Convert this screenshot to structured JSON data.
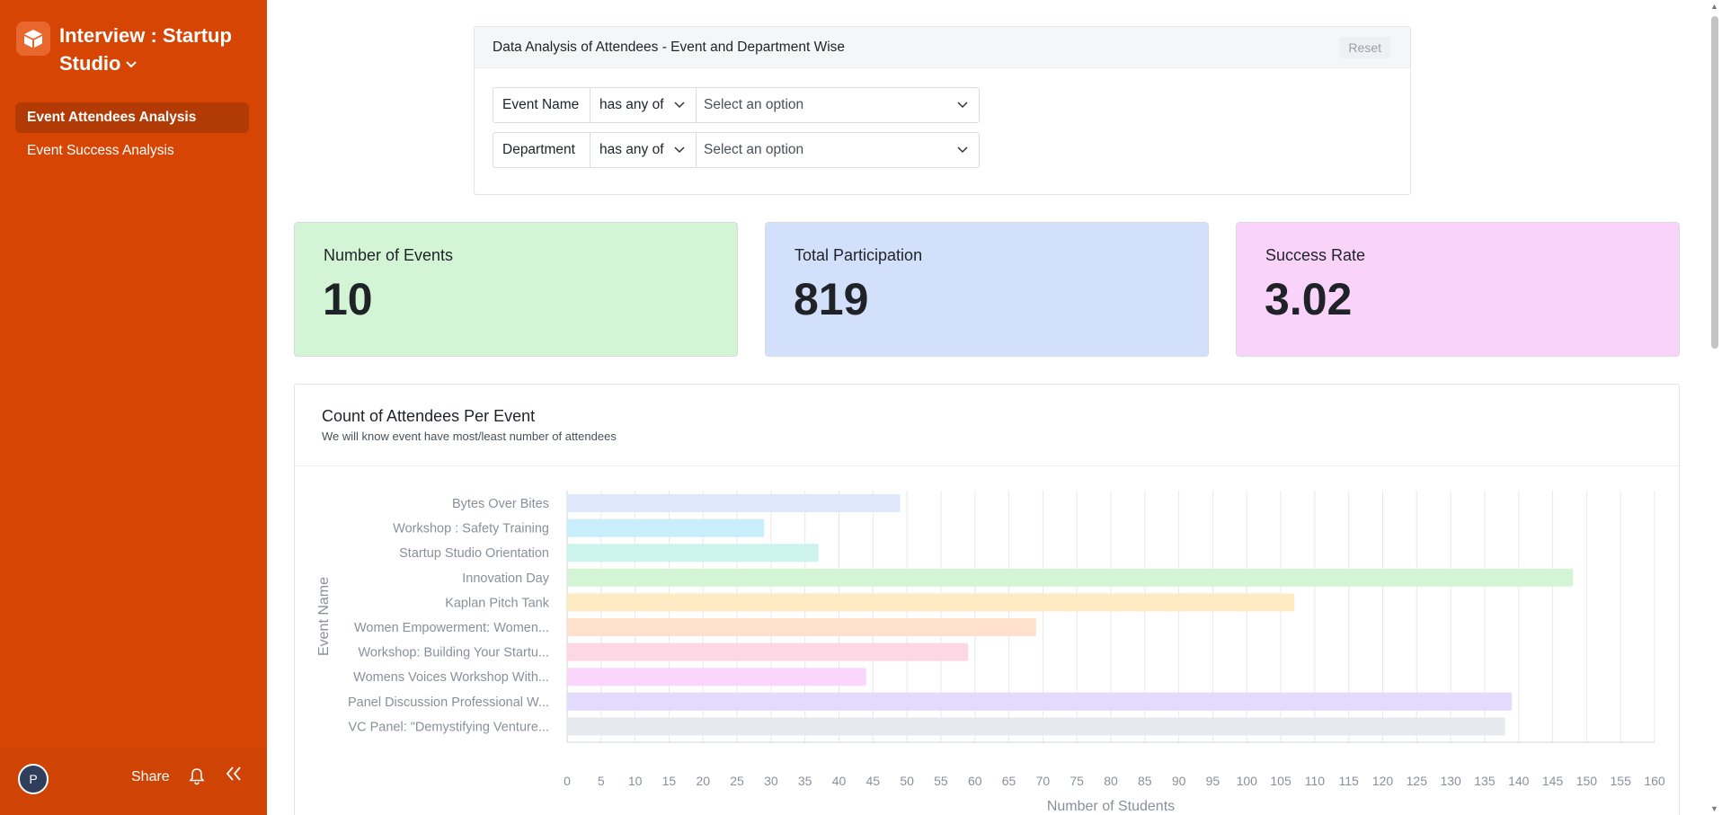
{
  "app": {
    "title": "Interview : Startup Studio",
    "title_line1": "Interview : Startup",
    "title_line2": "Studio"
  },
  "sidebar": {
    "items": [
      {
        "label": "Event Attendees Analysis",
        "active": true
      },
      {
        "label": "Event Success Analysis",
        "active": false
      }
    ],
    "footer": {
      "avatar_initial": "P",
      "share_label": "Share"
    }
  },
  "filters": {
    "title": "Data Analysis of Attendees - Event and Department Wise",
    "reset_label": "Reset",
    "rows": [
      {
        "field": "Event Name",
        "operator": "has any of",
        "placeholder": "Select an option"
      },
      {
        "field": "Department",
        "operator": "has any of",
        "placeholder": "Select an option"
      }
    ]
  },
  "kpis": {
    "events": {
      "label": "Number of Events",
      "value": "10"
    },
    "participation": {
      "label": "Total Participation",
      "value": "819"
    },
    "success": {
      "label": "Success Rate",
      "value": "3.02"
    }
  },
  "colors": {
    "sidebar": "#d64504",
    "kpi_events": "#d3f5d6",
    "kpi_participation": "#d3e0fc",
    "kpi_success": "#fad3fa"
  },
  "chart_data": {
    "type": "bar",
    "orientation": "horizontal",
    "title": "Count of Attendees Per Event",
    "subtitle": "We will know event have most/least number of attendees",
    "xlabel": "Number of Students",
    "ylabel": "Event Name",
    "xlim": [
      0,
      160
    ],
    "xticks": [
      0,
      5,
      10,
      15,
      20,
      25,
      30,
      35,
      40,
      45,
      50,
      55,
      60,
      65,
      70,
      75,
      80,
      85,
      90,
      95,
      100,
      105,
      110,
      115,
      120,
      125,
      130,
      135,
      140,
      145,
      150,
      155,
      160
    ],
    "grid": true,
    "categories": [
      "Bytes Over Bites",
      "Workshop : Safety Training",
      "Startup Studio Orientation",
      "Innovation Day",
      "Kaplan Pitch Tank",
      "Women Empowerment: Women...",
      "Workshop: Building Your Startu...",
      "Womens Voices Workshop With...",
      "Panel Discussion Professional W...",
      "VC Panel: \"Demystifying Venture..."
    ],
    "values": [
      49,
      29,
      37,
      148,
      107,
      69,
      59,
      44,
      139,
      138
    ],
    "bar_colors": [
      "#dfe7fd",
      "#c9eefb",
      "#ccf3ee",
      "#d3f5d6",
      "#feeac3",
      "#fee0cc",
      "#fdd7e3",
      "#fbd6fb",
      "#e2dbfd",
      "#e6e9ef"
    ]
  }
}
